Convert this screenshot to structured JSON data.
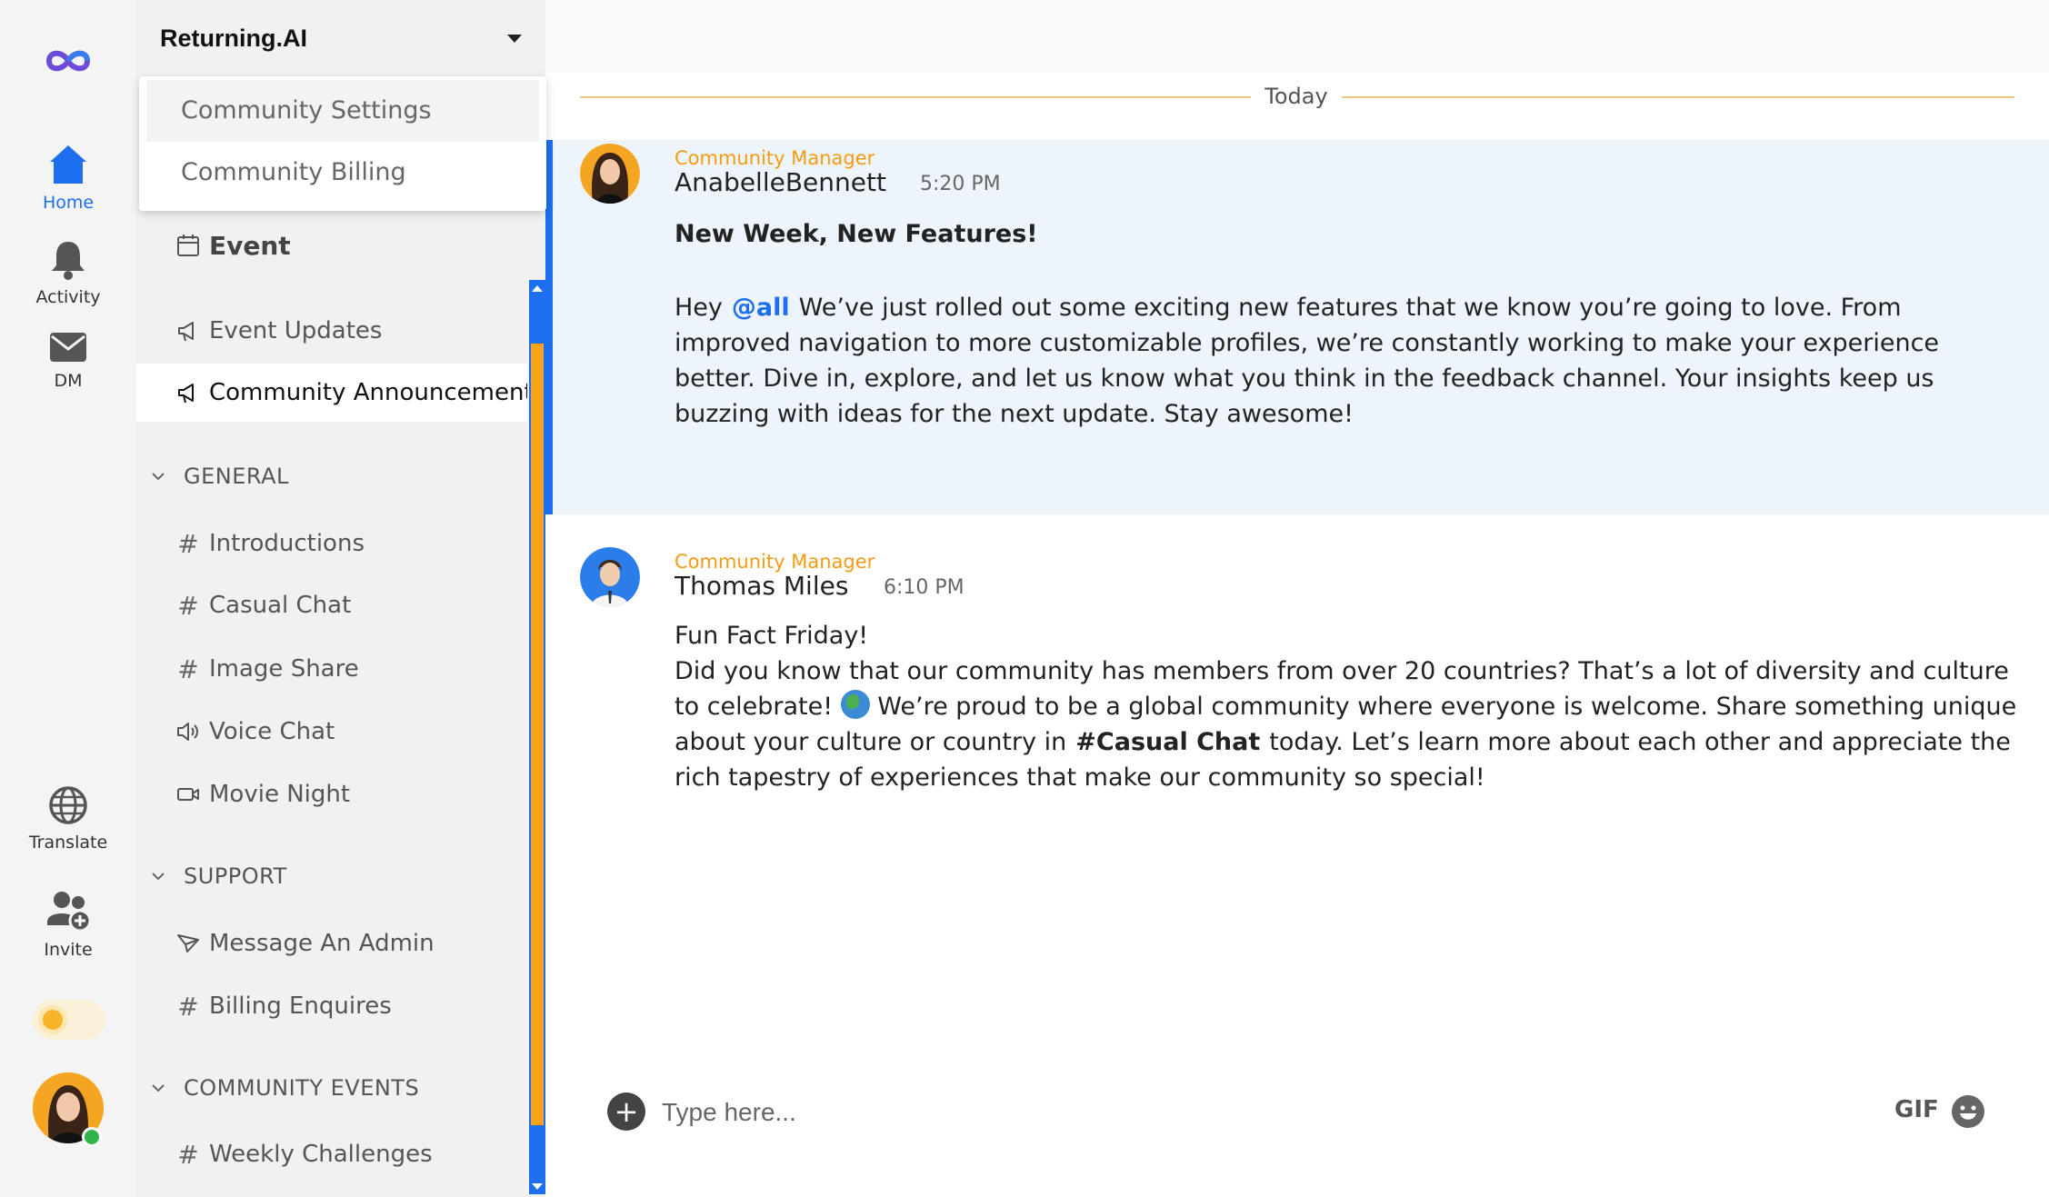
{
  "rail": {
    "home_label": "Home",
    "activity_label": "Activity",
    "dm_label": "DM",
    "translate_label": "Translate",
    "invite_label": "Invite"
  },
  "workspace": {
    "name": "Returning.AI",
    "menu": [
      "Community Settings",
      "Community Billing"
    ]
  },
  "sidebar": {
    "event_label": "Event",
    "channels_top": [
      "Event Updates",
      "Community Announcements"
    ],
    "sections": [
      {
        "title": "GENERAL",
        "items": [
          "Introductions",
          "Casual Chat",
          "Image Share",
          "Voice Chat",
          "Movie Night"
        ]
      },
      {
        "title": "SUPPORT",
        "items": [
          "Message An Admin",
          "Billing Enquires"
        ]
      },
      {
        "title": "COMMUNITY EVENTS",
        "items": [
          "Weekly Challenges"
        ]
      }
    ]
  },
  "feed": {
    "date_divider": "Today",
    "messages": [
      {
        "role": "Community Manager",
        "author": "AnabelleBennett",
        "time": "5:20 PM",
        "title": "New Week, New Features!",
        "pre_mention": "Hey",
        "mention": "@all",
        "text": "We’ve just rolled out some exciting new features that we know you’re going to love. From improved navigation to more customizable profiles, we’re constantly working to make your experience better. Dive in, explore, and let us know what you think in the feedback channel. Your insights keep us buzzing with ideas for the next update. Stay awesome!"
      },
      {
        "role": "Community Manager",
        "author": "Thomas Miles",
        "time": "6:10 PM",
        "title": "Fun Fact Friday!",
        "text_a": "Did you know that our community has members from over 20 countries? That’s a lot of diversity and culture to celebrate!",
        "text_b": "We’re proud to be a global community where everyone is welcome. Share something unique about your culture or country in",
        "channel_ref": "#Casual Chat",
        "text_c": "today. Let’s learn more about each other and appreciate the rich tapestry of experiences that make our community so special!"
      }
    ]
  },
  "composer": {
    "placeholder": "Type here...",
    "gif_label": "GIF"
  },
  "colors": {
    "accent_blue": "#1e6ff0",
    "accent_orange": "#f7a21b",
    "highlight_bg": "#edf4fb"
  }
}
